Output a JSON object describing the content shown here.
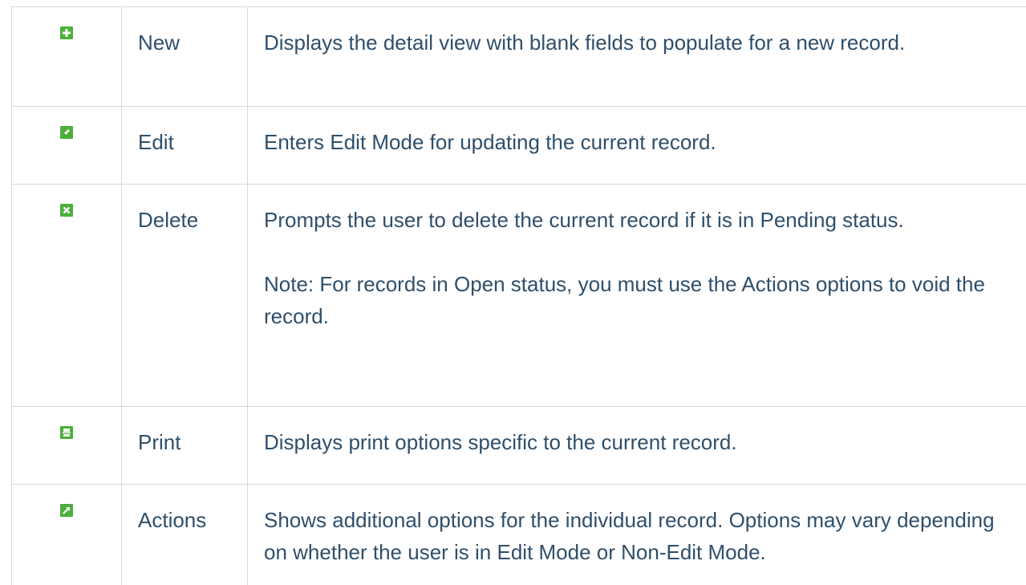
{
  "colors": {
    "icon_green": "#4caf3a",
    "icon_dark_green": "#2e7d32",
    "text": "#2f4f6b",
    "border": "#d9d9d9"
  },
  "rows": [
    {
      "icon": "plus-icon",
      "label": "New",
      "description": [
        "Displays the detail view with blank fields to populate for a new record."
      ]
    },
    {
      "icon": "pencil-icon",
      "label": "Edit",
      "description": [
        "Enters Edit Mode for updating the current record."
      ]
    },
    {
      "icon": "x-icon",
      "label": "Delete",
      "description": [
        "Prompts the user to delete the current record if it is in Pending status.",
        "Note: For records in Open status, you must use the Actions options to void the record."
      ]
    },
    {
      "icon": "printer-icon",
      "label": "Print",
      "description": [
        "Displays print options specific to the current record."
      ]
    },
    {
      "icon": "external-arrow-icon",
      "label": "Actions",
      "description": [
        "Shows additional options for the individual record. Options may vary depending on whether the user is in Edit Mode or Non-Edit Mode."
      ]
    }
  ]
}
